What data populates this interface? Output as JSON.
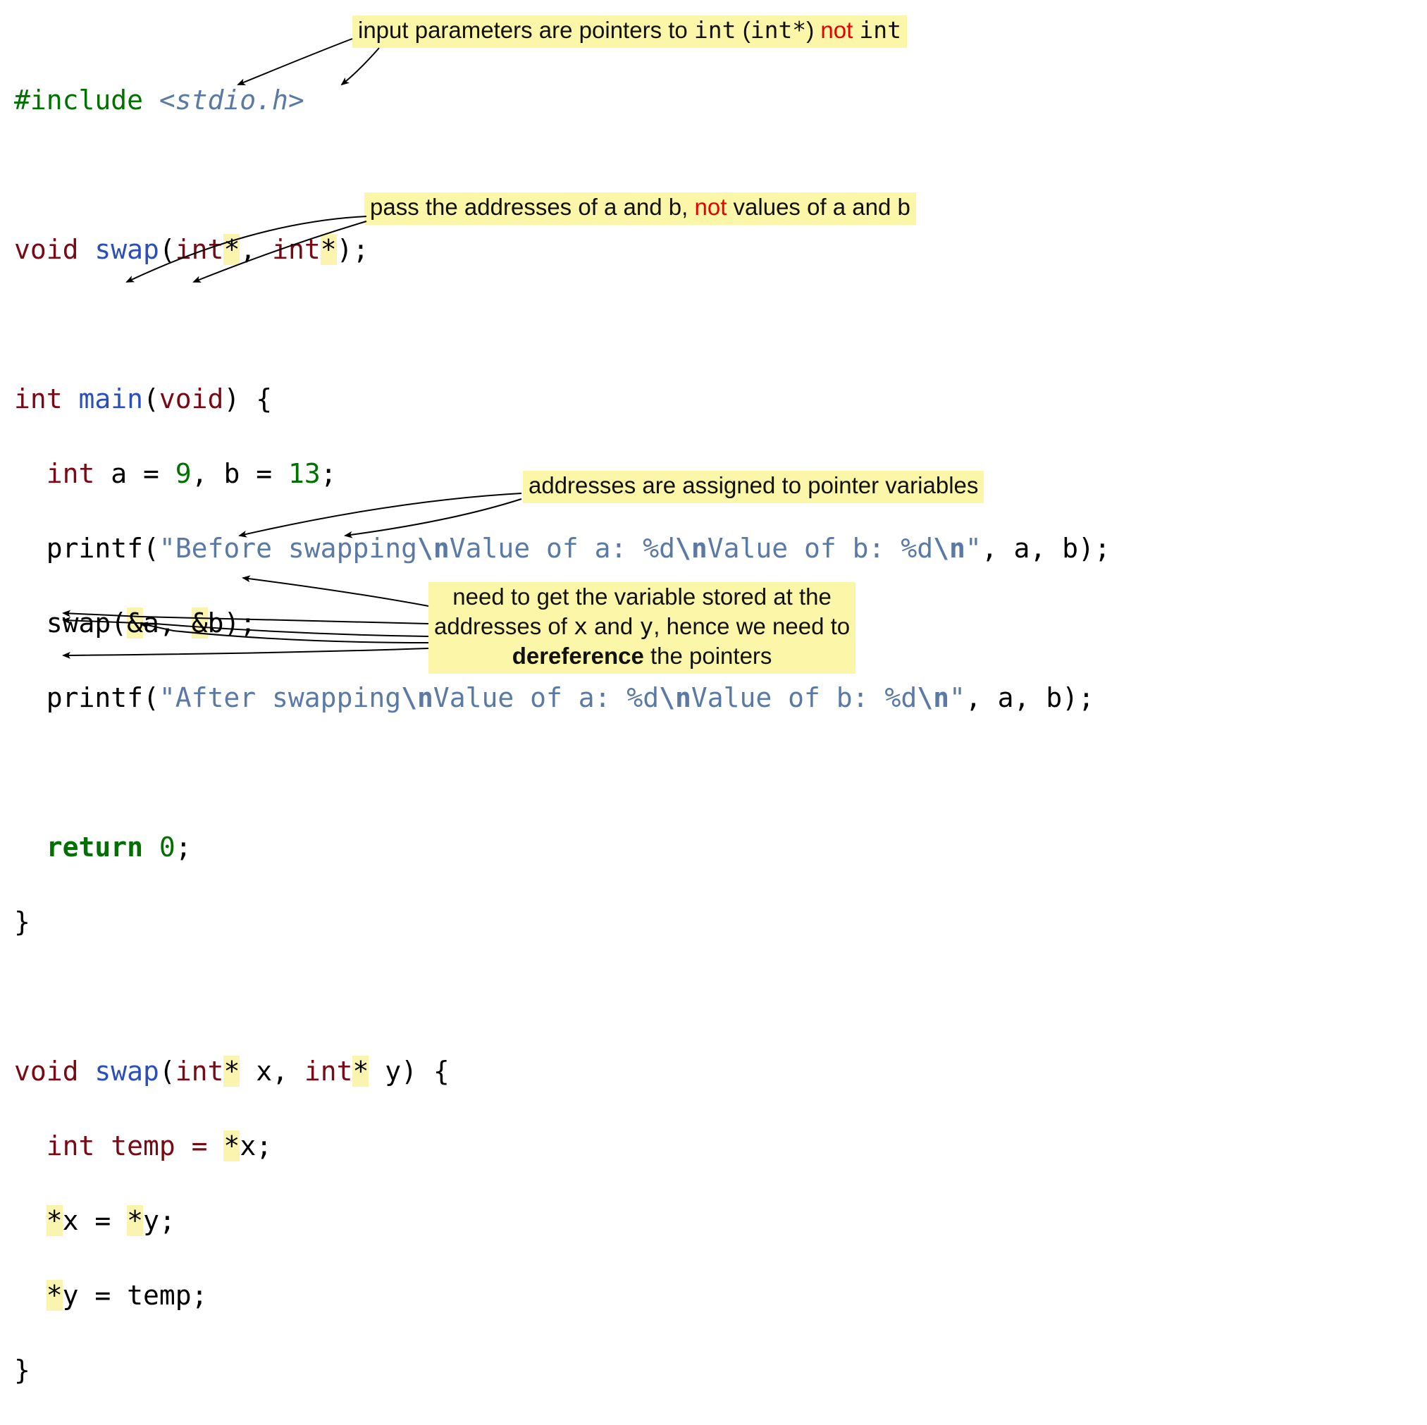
{
  "code": {
    "l1_include": "#include ",
    "l1_lib": "<stdio.h>",
    "l3_void": "void ",
    "l3_swap": "swap",
    "l3_paren_open": "(",
    "l3_int1": "int",
    "l3_star1": "*",
    "l3_comma": ", ",
    "l3_int2": "int",
    "l3_star2": "*",
    "l3_tail": ");",
    "l5_int": "int ",
    "l5_main": "main",
    "l5_paren": "(",
    "l5_void": "void",
    "l5_tail": ") {",
    "l6_pre": "  int ",
    "l6_a": "a = ",
    "l6_9": "9",
    "l6_mid": ", b = ",
    "l6_13": "13",
    "l6_semi": ";",
    "l7_pre": "  printf(",
    "l7_str_a": "\"Before swapping",
    "l7_esc1": "\\n",
    "l7_str_b": "Value of a: %d",
    "l7_esc2": "\\n",
    "l7_str_c": "Value of b: %d",
    "l7_esc3": "\\n",
    "l7_str_d": "\"",
    "l7_tail": ", a, b);",
    "l8_pre": "  swap(",
    "l8_amp1": "&",
    "l8_a": "a, ",
    "l8_amp2": "&",
    "l8_b": "b);",
    "l9_pre": "  printf(",
    "l9_str_a": "\"After swapping",
    "l9_esc1": "\\n",
    "l9_str_b": "Value of a: %d",
    "l9_esc2": "\\n",
    "l9_str_c": "Value of b: %d",
    "l9_esc3": "\\n",
    "l9_str_d": "\"",
    "l9_tail": ", a, b);",
    "l11_pre": "  ",
    "l11_return": "return ",
    "l11_zero": "0",
    "l11_semi": ";",
    "l12_brace": "}",
    "l14_void": "void ",
    "l14_swap": "swap",
    "l14_po": "(",
    "l14_int1": "int",
    "l14_star1": "*",
    "l14_sp1": " x, ",
    "l14_int2": "int",
    "l14_star2": "*",
    "l14_tail": " y) {",
    "l15_pre": "  int temp = ",
    "l15_deref": "*",
    "l15_tail": "x;",
    "l16_pre": "  ",
    "l16_starx": "*",
    "l16_x": "x = ",
    "l16_stary": "*",
    "l16_y": "y;",
    "l17_pre": "  ",
    "l17_stary": "*",
    "l17_yeq": "y = temp;",
    "l18_brace": "}"
  },
  "notes": {
    "n1_a": "input parameters are pointers to ",
    "n1_b": "int",
    "n1_c": " (",
    "n1_d": "int*",
    "n1_e": ") ",
    "n1_f": "not",
    "n1_g": " ",
    "n1_h": "int",
    "n2_a": "pass the addresses of a and b, ",
    "n2_b": "not",
    "n2_c": " values of a and b",
    "n3": "addresses are assigned to pointer variables",
    "n4_a": "need to get the variable stored at the",
    "n4_b": "addresses of ",
    "n4_c": "x",
    "n4_d": " and ",
    "n4_e": "y",
    "n4_f": ", hence we need to",
    "n4_g": "dereference",
    "n4_h": " the pointers"
  }
}
